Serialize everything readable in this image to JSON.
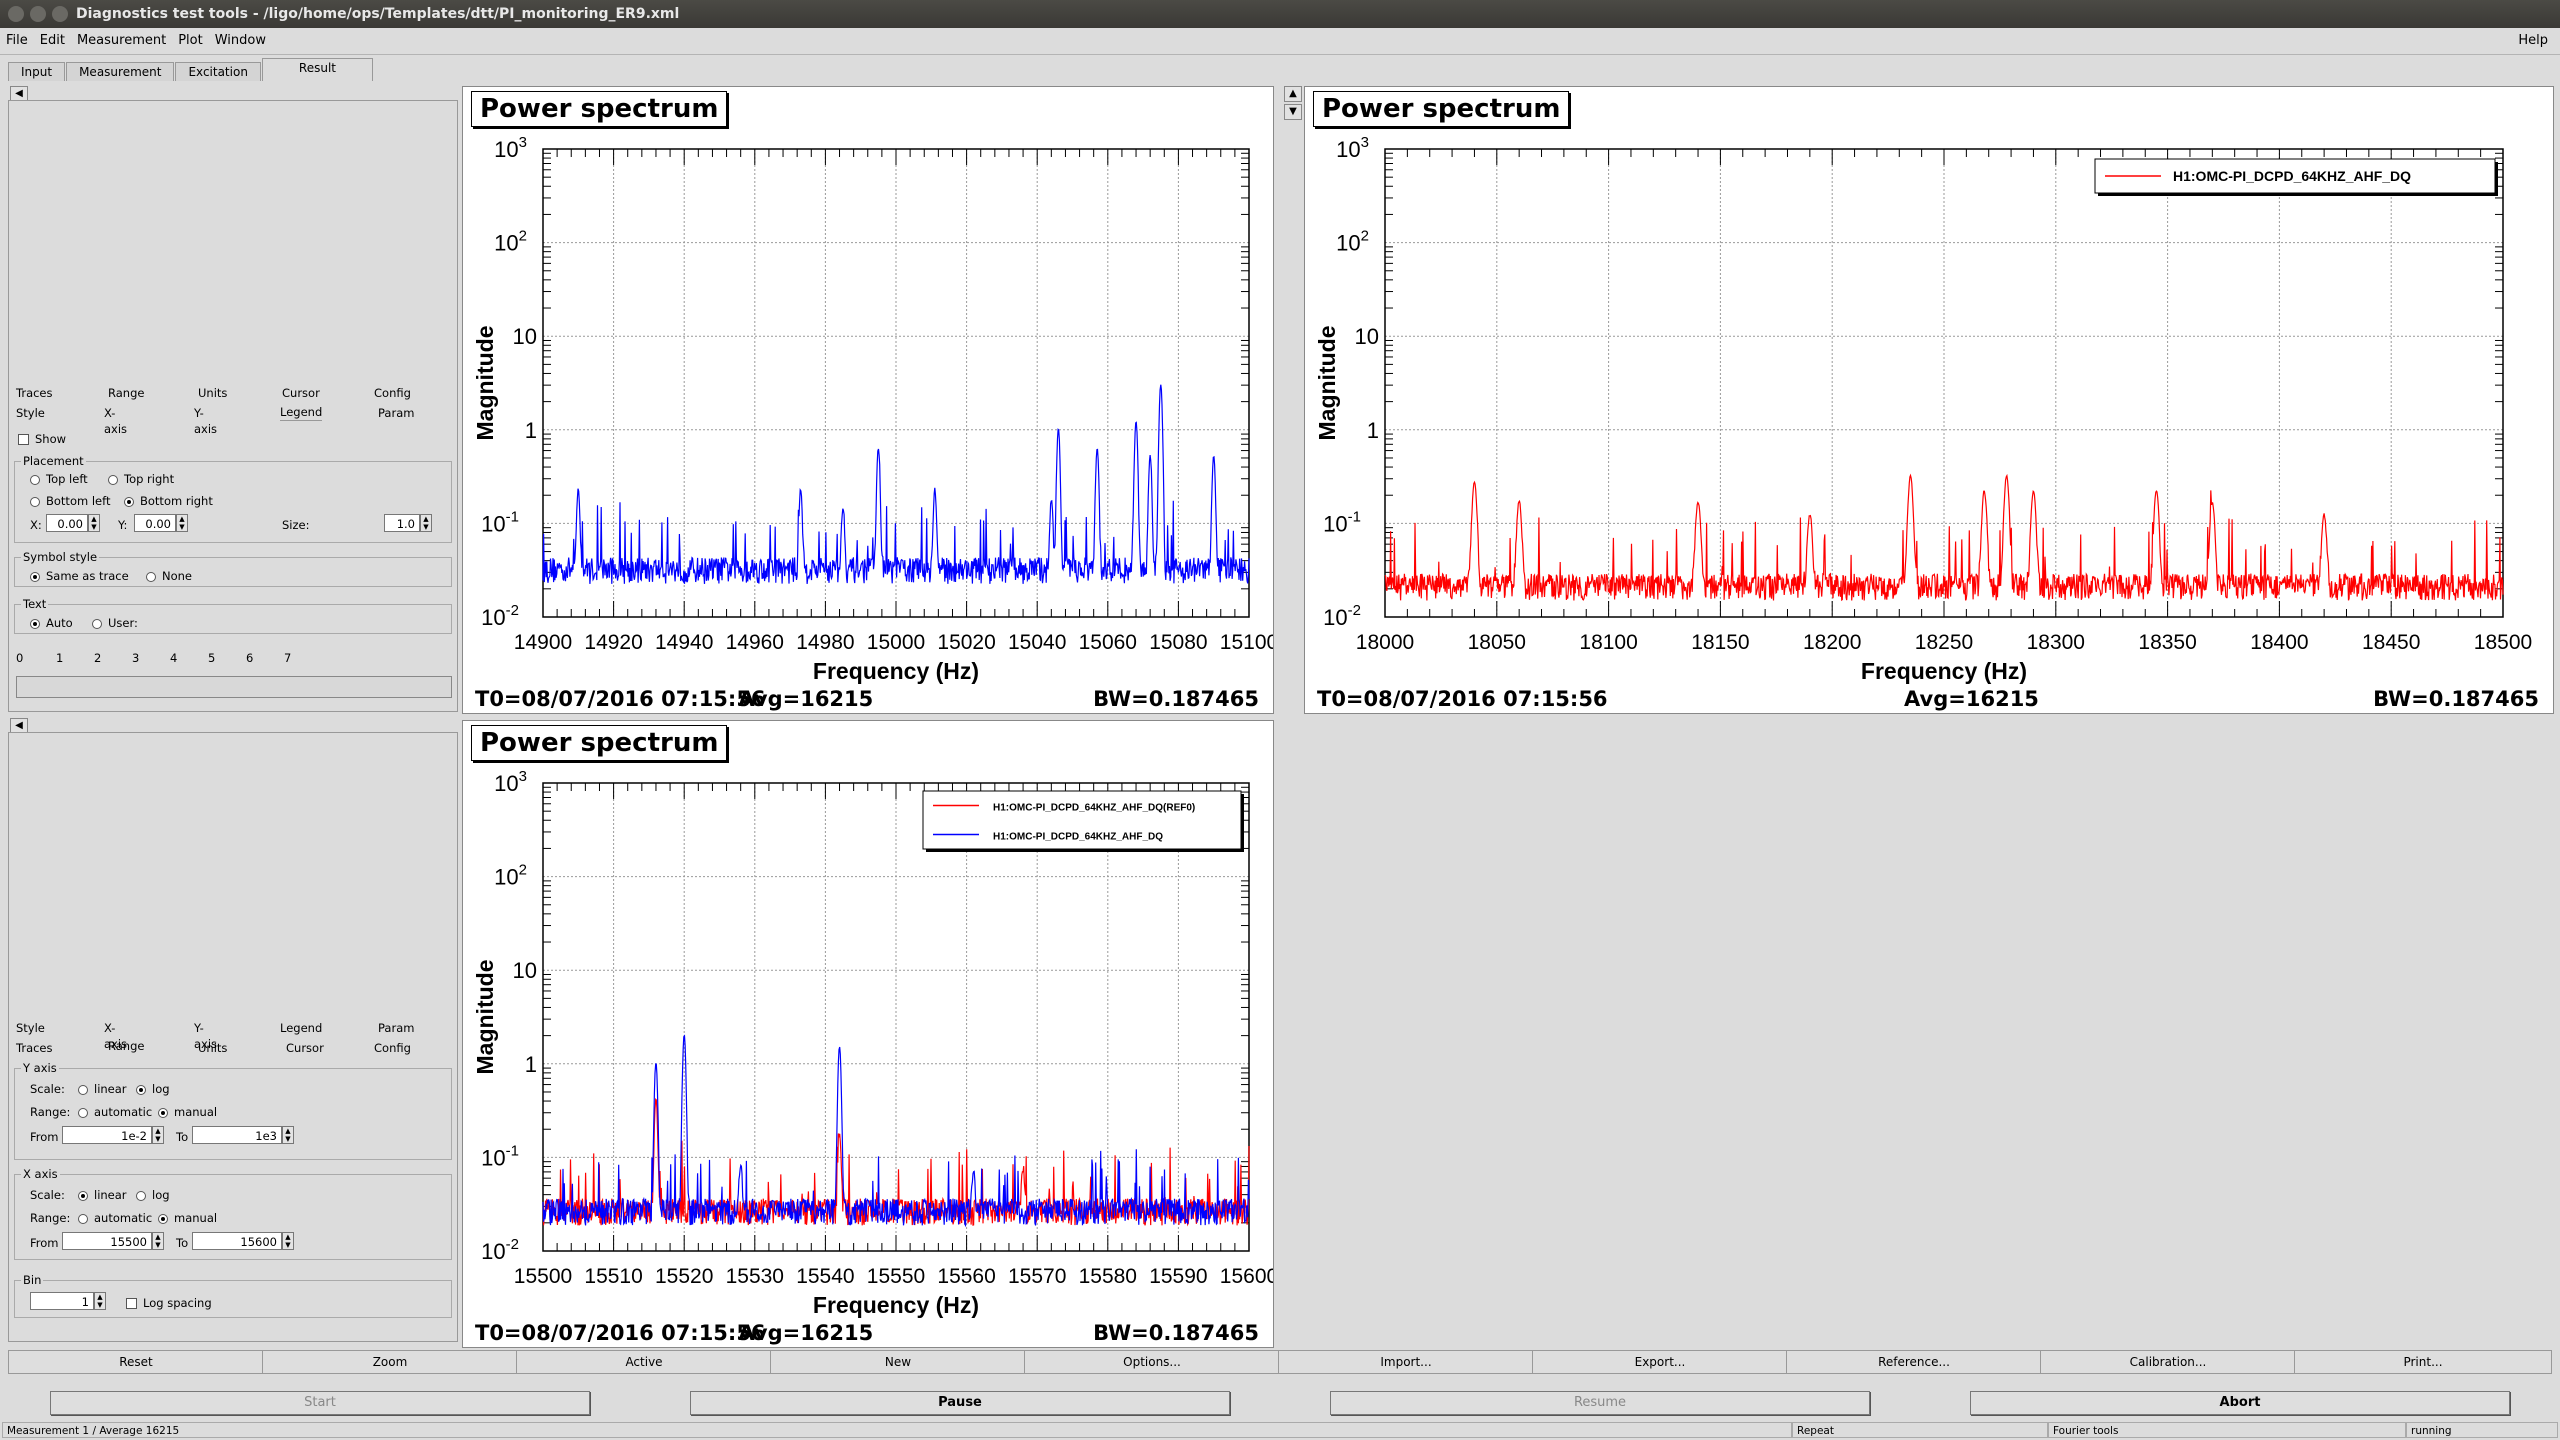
{
  "window": {
    "title": "Diagnostics test tools - /ligo/home/ops/Templates/dtt/PI_monitoring_ER9.xml"
  },
  "menu": [
    "File",
    "Edit",
    "Measurement",
    "Plot",
    "Window"
  ],
  "menu_help": "Help",
  "main_tabs": [
    {
      "label": "Input"
    },
    {
      "label": "Measurement"
    },
    {
      "label": "Excitation"
    },
    {
      "label": "Result",
      "active": true
    }
  ],
  "panel1": {
    "tabs_row1": [
      "Traces",
      "Range",
      "Units",
      "Cursor",
      "Config"
    ],
    "tabs_row2": [
      "Style",
      "X-axis",
      "Y-axis",
      "Legend",
      "Param"
    ],
    "show_label": "Show",
    "placement": {
      "group": "Placement",
      "top_left": "Top left",
      "top_right": "Top right",
      "bottom_left": "Bottom left",
      "bottom_right": "Bottom right",
      "x_label": "X:",
      "x_value": "0.00",
      "y_label": "Y:",
      "y_value": "0.00",
      "size_label": "Size:",
      "size_value": "1.0"
    },
    "symbol": {
      "group": "Symbol style",
      "same": "Same as trace",
      "none": "None"
    },
    "text": {
      "group": "Text",
      "auto": "Auto",
      "user": "User:"
    },
    "num_tabs": [
      "0",
      "1",
      "2",
      "3",
      "4",
      "5",
      "6",
      "7"
    ]
  },
  "panel2": {
    "tabs_row1": [
      "Style",
      "X-axis",
      "Y-axis",
      "Legend",
      "Param"
    ],
    "tabs_row2": [
      "Traces",
      "Range",
      "Units",
      "Cursor",
      "Config"
    ],
    "yaxis": {
      "group": "Y axis",
      "scale_label": "Scale:",
      "linear": "linear",
      "log": "log",
      "range_label": "Range:",
      "automatic": "automatic",
      "manual": "manual",
      "from_label": "From",
      "from_value": "1e-2",
      "to_label": "To",
      "to_value": "1e3"
    },
    "xaxis": {
      "group": "X axis",
      "scale_label": "Scale:",
      "linear": "linear",
      "log": "log",
      "range_label": "Range:",
      "automatic": "automatic",
      "manual": "manual",
      "from_label": "From",
      "from_value": "15500",
      "to_label": "To",
      "to_value": "15600"
    },
    "bin": {
      "group": "Bin",
      "value": "1",
      "log_spacing": "Log spacing"
    }
  },
  "plots": [
    {
      "title": "Power spectrum",
      "xlabel": "Frequency (Hz)",
      "ylabel": "Magnitude",
      "t0": "T0=08/07/2016 07:15:56",
      "avg": "Avg=16215",
      "bw": "BW=0.187465",
      "xticks": [
        "14900",
        "14920",
        "14940",
        "14960",
        "14980",
        "15000",
        "15020",
        "15040",
        "15060",
        "15080",
        "15100"
      ],
      "yticks": [
        "10",
        "10",
        "10",
        "1",
        "10",
        "10"
      ],
      "yexp": [
        "3",
        "2",
        "",
        "",
        "-1",
        "-2"
      ],
      "legend": []
    },
    {
      "title": "Power spectrum",
      "xlabel": "Frequency (Hz)",
      "ylabel": "Magnitude",
      "t0": "T0=08/07/2016 07:15:56",
      "avg": "Avg=16215",
      "bw": "BW=0.187465",
      "xticks": [
        "18000",
        "18050",
        "18100",
        "18150",
        "18200",
        "18250",
        "18300",
        "18350",
        "18400",
        "18450",
        "18500"
      ],
      "yticks": [
        "10",
        "10",
        "10",
        "1",
        "10",
        "10"
      ],
      "yexp": [
        "3",
        "2",
        "",
        "",
        "-1",
        "-2"
      ],
      "legend": [
        "H1:OMC-PI_DCPD_64KHZ_AHF_DQ"
      ]
    },
    {
      "title": "Power spectrum",
      "xlabel": "Frequency (Hz)",
      "ylabel": "Magnitude",
      "t0": "T0=08/07/2016 07:15:56",
      "avg": "Avg=16215",
      "bw": "BW=0.187465",
      "xticks": [
        "15500",
        "15510",
        "15520",
        "15530",
        "15540",
        "15550",
        "15560",
        "15570",
        "15580",
        "15590",
        "15600"
      ],
      "yticks": [
        "10",
        "10",
        "10",
        "1",
        "10",
        "10"
      ],
      "yexp": [
        "3",
        "2",
        "",
        "",
        "-1",
        "-2"
      ],
      "legend": [
        "H1:OMC-PI_DCPD_64KHZ_AHF_DQ(REF0)",
        "H1:OMC-PI_DCPD_64KHZ_AHF_DQ"
      ]
    }
  ],
  "chart_data": [
    {
      "type": "line",
      "title": "Power spectrum",
      "xlabel": "Frequency (Hz)",
      "ylabel": "Magnitude",
      "xlim": [
        14900,
        15100
      ],
      "ylim": [
        0.01,
        1000
      ],
      "yscale": "log",
      "grid": true,
      "series_color": "#0000ff",
      "peaks": [
        [
          14910,
          0.2
        ],
        [
          14973,
          0.2
        ],
        [
          14985,
          0.12
        ],
        [
          14995,
          0.6
        ],
        [
          15011,
          0.2
        ],
        [
          15044,
          0.15
        ],
        [
          15046,
          1
        ],
        [
          15057,
          0.6
        ],
        [
          15068,
          1.2
        ],
        [
          15072,
          0.5
        ],
        [
          15075,
          3
        ],
        [
          15090,
          0.5
        ]
      ],
      "noise_floor": 0.03
    },
    {
      "type": "line",
      "title": "Power spectrum",
      "xlabel": "Frequency (Hz)",
      "ylabel": "Magnitude",
      "xlim": [
        18000,
        18500
      ],
      "ylim": [
        0.01,
        1000
      ],
      "yscale": "log",
      "grid": true,
      "legend": "top-right",
      "series_color": "#ff0000",
      "peaks": [
        [
          18040,
          0.25
        ],
        [
          18060,
          0.15
        ],
        [
          18140,
          0.15
        ],
        [
          18190,
          0.1
        ],
        [
          18235,
          0.3
        ],
        [
          18268,
          0.2
        ],
        [
          18278,
          0.3
        ],
        [
          18290,
          0.2
        ],
        [
          18345,
          0.2
        ],
        [
          18370,
          0.15
        ],
        [
          18420,
          0.1
        ]
      ],
      "noise_floor": 0.02
    },
    {
      "type": "line",
      "title": "Power spectrum",
      "xlabel": "Frequency (Hz)",
      "ylabel": "Magnitude",
      "xlim": [
        15500,
        15600
      ],
      "ylim": [
        0.01,
        1000
      ],
      "yscale": "log",
      "grid": true,
      "legend": "top-right",
      "series": [
        {
          "color": "#ff0000",
          "peaks": [
            [
              15516,
              0.4
            ],
            [
              15542,
              0.15
            ],
            [
              15568,
              0.05
            ]
          ],
          "noise_floor": 0.025
        },
        {
          "color": "#0000ff",
          "peaks": [
            [
              15516,
              1
            ],
            [
              15520,
              2
            ],
            [
              15528,
              0.06
            ],
            [
              15542,
              1.5
            ],
            [
              15561,
              0.05
            ]
          ],
          "noise_floor": 0.025
        }
      ]
    }
  ],
  "toolbar": [
    "Reset",
    "Zoom",
    "Active",
    "New",
    "Options...",
    "Import...",
    "Export...",
    "Reference...",
    "Calibration...",
    "Print..."
  ],
  "bigbar": [
    "Start",
    "Pause",
    "Resume",
    "Abort"
  ],
  "status": {
    "left": "Measurement 1 / Average 16215",
    "repeat": "Repeat",
    "fourier": "Fourier tools",
    "state": "running"
  }
}
